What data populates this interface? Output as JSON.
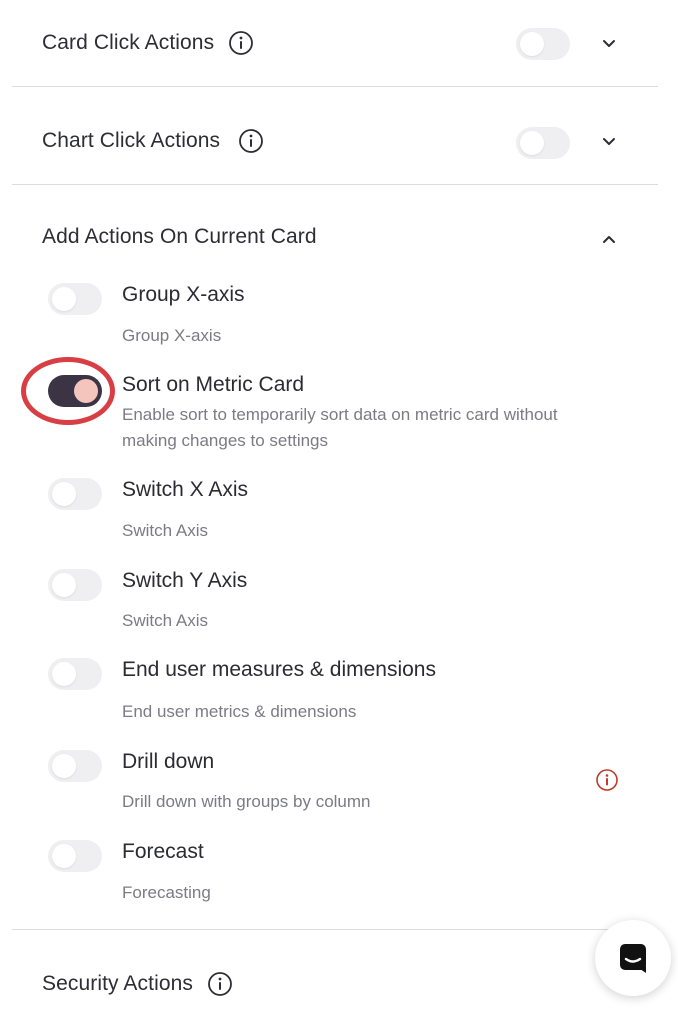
{
  "sections": {
    "card_click": {
      "title": "Card Click Actions",
      "enabled": false,
      "expanded": false
    },
    "chart_click": {
      "title": "Chart Click Actions",
      "enabled": false,
      "expanded": false
    },
    "add_actions": {
      "title": "Add Actions On Current Card",
      "expanded": true
    },
    "security": {
      "title": "Security Actions"
    }
  },
  "items": [
    {
      "title": "Group X-axis",
      "description": "Group X-axis",
      "enabled": false
    },
    {
      "title": "Sort on Metric Card",
      "description": "Enable sort to temporarily sort data on metric card without making changes to settings",
      "enabled": true,
      "highlighted": true
    },
    {
      "title": "Switch X Axis",
      "description": "Switch Axis",
      "enabled": false
    },
    {
      "title": "Switch Y Axis",
      "description": "Switch Axis",
      "enabled": false
    },
    {
      "title": "End user measures & dimensions",
      "description": "End user metrics & dimensions",
      "enabled": false
    },
    {
      "title": "Drill down",
      "description": "Drill down with groups by column",
      "enabled": false,
      "warning_icon": "info-icon"
    },
    {
      "title": "Forecast",
      "description": "Forecasting",
      "enabled": false
    }
  ],
  "colors": {
    "toggle_on_track": "#3c3345",
    "toggle_on_knob": "#f3c5bd",
    "toggle_off_track": "#efeff2",
    "highlight": "#d83f45",
    "warning_info": "#c0392b"
  }
}
